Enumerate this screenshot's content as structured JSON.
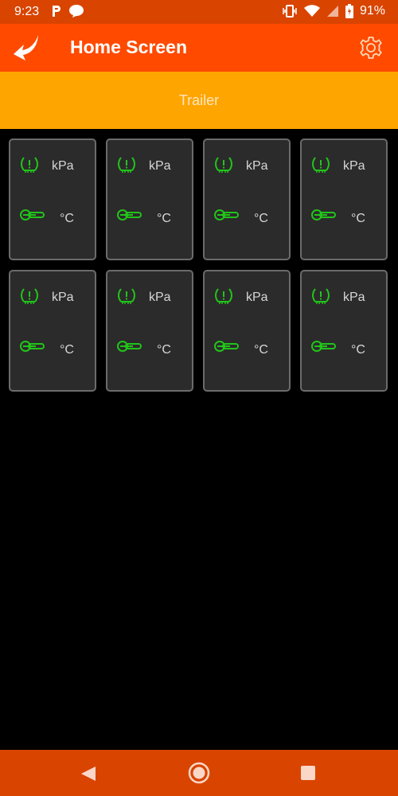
{
  "status_bar": {
    "time": "9:23",
    "battery_percent": "91%",
    "left_icons": [
      "parking-icon",
      "chat-bubble-icon"
    ],
    "right_icons": [
      "vibrate-icon",
      "wifi-icon",
      "signal-icon",
      "battery-icon"
    ]
  },
  "app_bar": {
    "title": "Home Screen",
    "back_icon": "curved-back-arrow-icon",
    "settings_icon": "gear-icon"
  },
  "section": {
    "title": "Trailer"
  },
  "sensors": [
    {
      "pressure_unit": "kPa",
      "temp_unit": "°C"
    },
    {
      "pressure_unit": "kPa",
      "temp_unit": "°C"
    },
    {
      "pressure_unit": "kPa",
      "temp_unit": "°C"
    },
    {
      "pressure_unit": "kPa",
      "temp_unit": "°C"
    },
    {
      "pressure_unit": "kPa",
      "temp_unit": "°C"
    },
    {
      "pressure_unit": "kPa",
      "temp_unit": "°C"
    },
    {
      "pressure_unit": "kPa",
      "temp_unit": "°C"
    },
    {
      "pressure_unit": "kPa",
      "temp_unit": "°C"
    }
  ],
  "colors": {
    "status_bar": "#d94400",
    "app_bar": "#ff4a00",
    "section_bar": "#ffa500",
    "card_bg": "#2b2b2b",
    "card_border": "#6b6b6b",
    "sensor_icon": "#22c41a"
  },
  "nav_bar": {
    "icons": [
      "back-triangle-icon",
      "home-circle-icon",
      "recents-square-icon"
    ]
  }
}
